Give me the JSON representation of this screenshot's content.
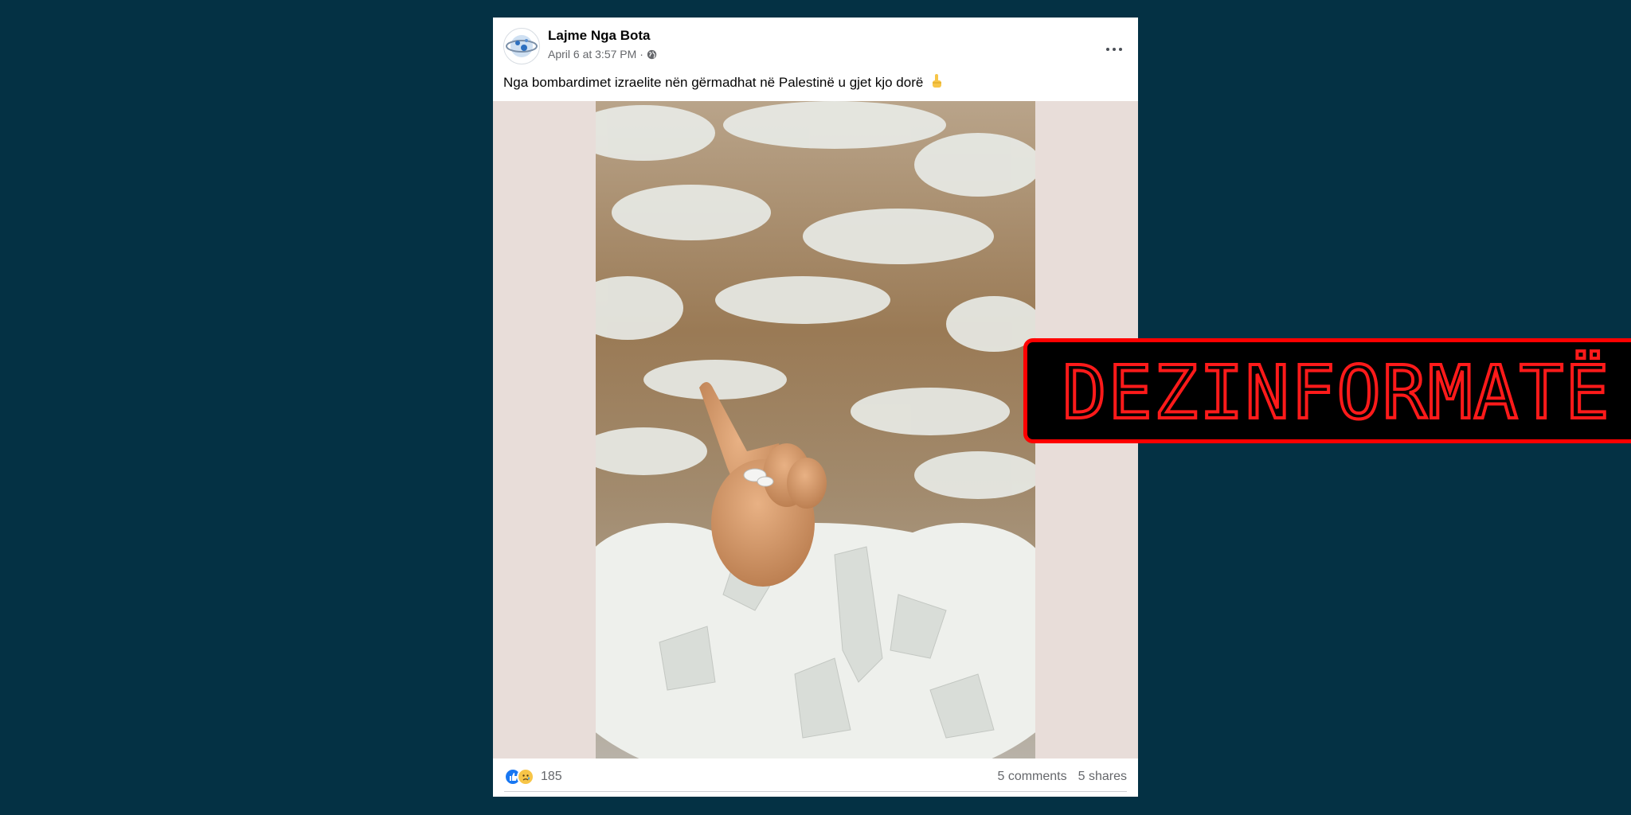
{
  "post": {
    "page_name": "Lajme Nga Bota",
    "timestamp": "April 6 at 3:57 PM",
    "separator": "·",
    "text": "Nga bombardimet izraelite nën gërmadhat në Palestinë u gjet kjo dorë",
    "text_icon": "pointing-up-finger-icon",
    "reaction_count": "185",
    "reaction_icons": [
      "like-icon",
      "sad-icon"
    ],
    "comments": "5 comments",
    "shares": "5 shares",
    "audience_icon": "globe-icon"
  },
  "label": {
    "text": "DEZINFORMATË",
    "color": "#ff1a1a"
  },
  "colors": {
    "background": "#043144",
    "card": "#ffffff",
    "media_fill": "#e8ddd9",
    "label_border": "#ff0000"
  }
}
